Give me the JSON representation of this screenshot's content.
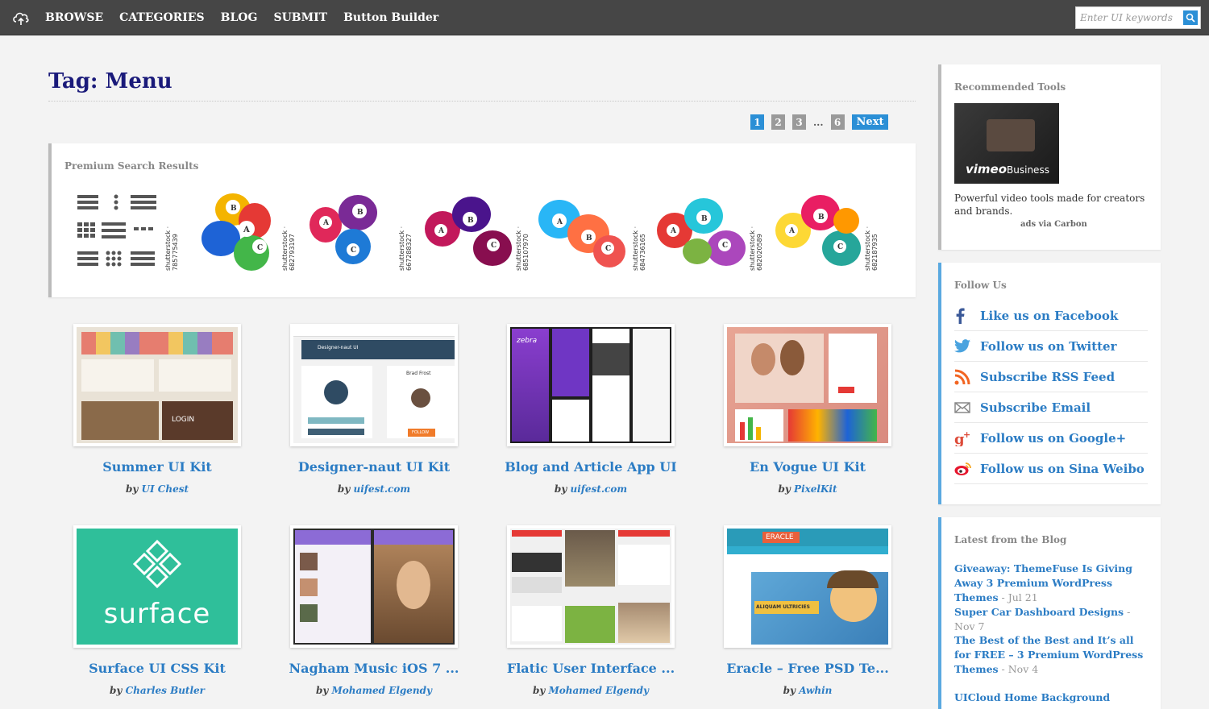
{
  "nav": {
    "items": [
      "BROWSE",
      "CATEGORIES",
      "BLOG",
      "SUBMIT",
      "Button Builder"
    ],
    "search_placeholder": "Enter UI keywords"
  },
  "page": {
    "title": "Tag: Menu",
    "pagination": {
      "pages": [
        "1",
        "2",
        "3",
        "...",
        "6"
      ],
      "current": "1",
      "next": "Next"
    }
  },
  "premium": {
    "title": "Premium Search Results",
    "stock_ids": [
      "shutterstock · 785775439",
      "shutterstock · 682793197",
      "shutterstock · 667288327",
      "shutterstock · 685107970",
      "shutterstock · 684736165",
      "shutterstock · 682020589",
      "shutterstock · 682187935"
    ]
  },
  "cards": [
    {
      "title": "Summer UI Kit",
      "by": "by",
      "author": "UI Chest"
    },
    {
      "title": "Designer-naut UI Kit",
      "by": "by",
      "author": "uifest.com"
    },
    {
      "title": "Blog and Article App UI",
      "by": "by",
      "author": "uifest.com"
    },
    {
      "title": "En Vogue UI Kit",
      "by": "by",
      "author": "PixelKit"
    },
    {
      "title": "Surface UI CSS Kit",
      "by": "by",
      "author": "Charles Butler"
    },
    {
      "title": "Nagham Music iOS 7 ...",
      "by": "by",
      "author": "Mohamed Elgendy"
    },
    {
      "title": "Flatic User Interface ...",
      "by": "by",
      "author": "Mohamed Elgendy"
    },
    {
      "title": "Eracle – Free PSD Te...",
      "by": "by",
      "author": "Awhin"
    }
  ],
  "thumb_text": {
    "surface": "surface",
    "eracle": "ERACLE",
    "eracle_banner": "ALIQUAM ULTRICIES",
    "login": "LOGIN",
    "zebra": "zebra",
    "designer": "Designer-naut UI",
    "brad": "Brad Frost",
    "follow": "FOLLOW"
  },
  "sidebar": {
    "ad": {
      "title": "Recommended Tools",
      "brand": "vimeo",
      "brand_sub": "Business",
      "text": "Powerful video tools made for creators and brands.",
      "via": "ads via Carbon"
    },
    "follow": {
      "title": "Follow Us",
      "items": [
        {
          "icon": "facebook-icon",
          "label": "Like us on Facebook"
        },
        {
          "icon": "twitter-icon",
          "label": "Follow us on Twitter"
        },
        {
          "icon": "rss-icon",
          "label": "Subscribe RSS Feed"
        },
        {
          "icon": "email-icon",
          "label": "Subscribe Email"
        },
        {
          "icon": "googleplus-icon",
          "label": "Follow us on Google+"
        },
        {
          "icon": "weibo-icon",
          "label": "Follow us on Sina Weibo"
        }
      ]
    },
    "blog": {
      "title": "Latest from the Blog",
      "items": [
        {
          "title": "Giveaway: ThemeFuse Is Giving Away 3 Premium WordPress Themes",
          "date": " - Jul 21"
        },
        {
          "title": "Super Car Dashboard Designs",
          "date": " - Nov 7"
        },
        {
          "title": "The Best of the Best and It’s all for FREE – 3 Premium WordPress Themes",
          "date": " - Nov 4"
        },
        {
          "title": "UICloud Home Background",
          "date": ""
        }
      ]
    }
  },
  "colors": {
    "accent": "#2b8fd6",
    "nav_bg": "#464646",
    "title": "#1a1a7a",
    "link": "#2b7cc4"
  }
}
